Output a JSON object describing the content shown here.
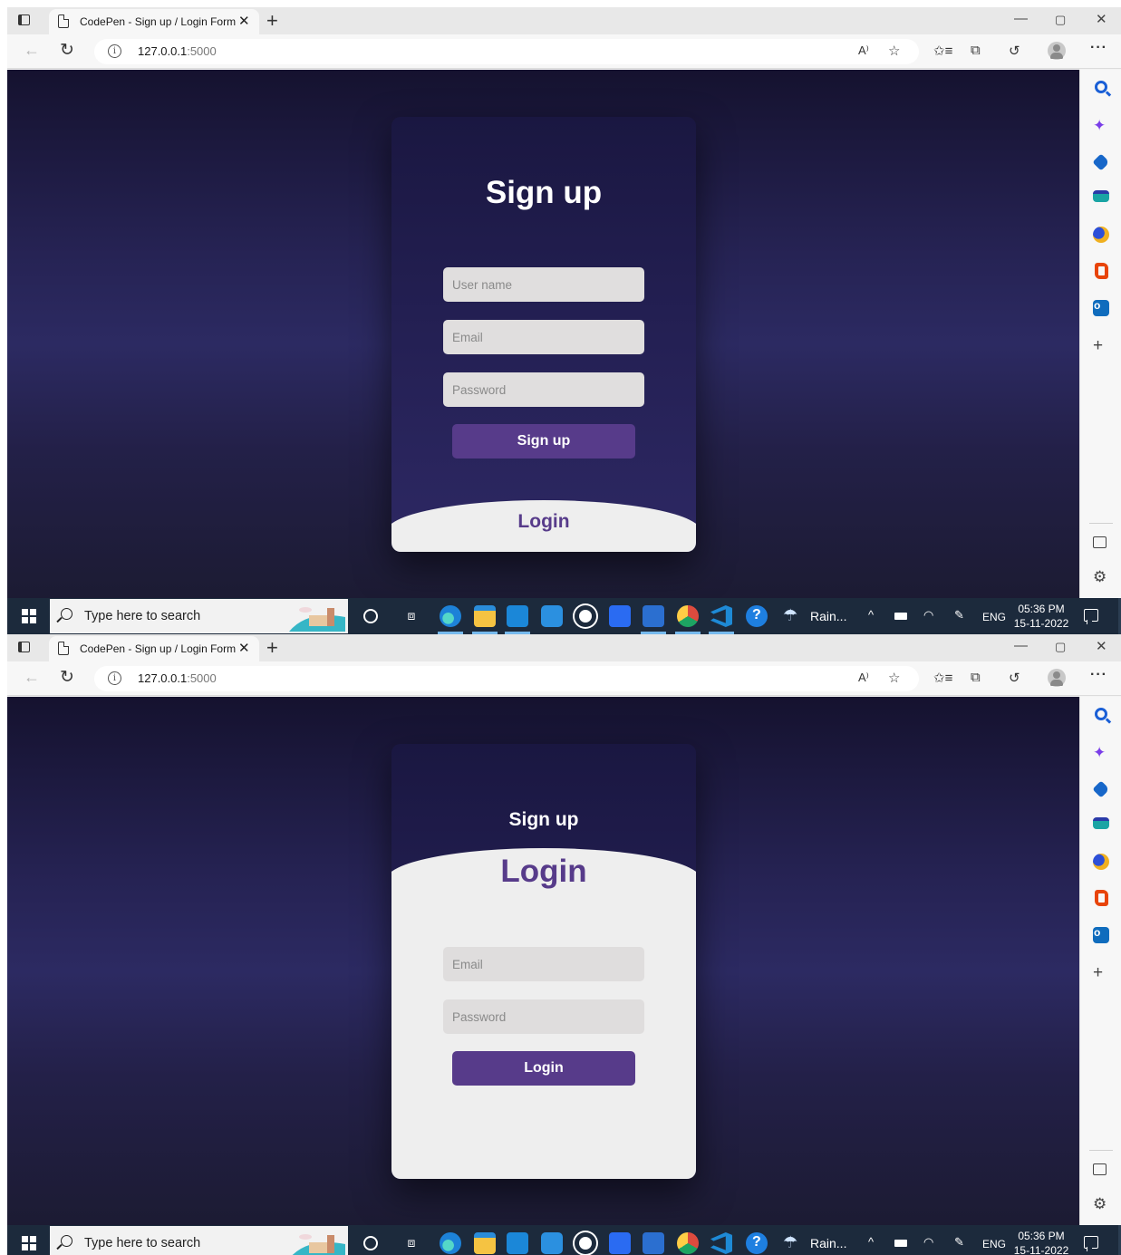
{
  "browser": {
    "tab_title": "CodePen - Sign up / Login Form",
    "url_host": "127.0.0.1",
    "url_port": ":5000"
  },
  "screen_signup": {
    "signup_heading": "Sign up",
    "username_placeholder": "User name",
    "email_placeholder": "Email",
    "password_placeholder": "Password",
    "signup_button": "Sign up",
    "login_heading": "Login"
  },
  "screen_login": {
    "signup_heading": "Sign up",
    "login_heading": "Login",
    "email_placeholder": "Email",
    "password_placeholder": "Password",
    "login_button": "Login"
  },
  "taskbar": {
    "search_placeholder": "Type here to search",
    "weather_text": "Rain...",
    "language": "ENG",
    "time": "05:36 PM",
    "date": "15-11-2022"
  },
  "colors": {
    "accent_purple": "#573b8a",
    "panel_light": "#eeeeee",
    "background_dark": "#262354"
  }
}
